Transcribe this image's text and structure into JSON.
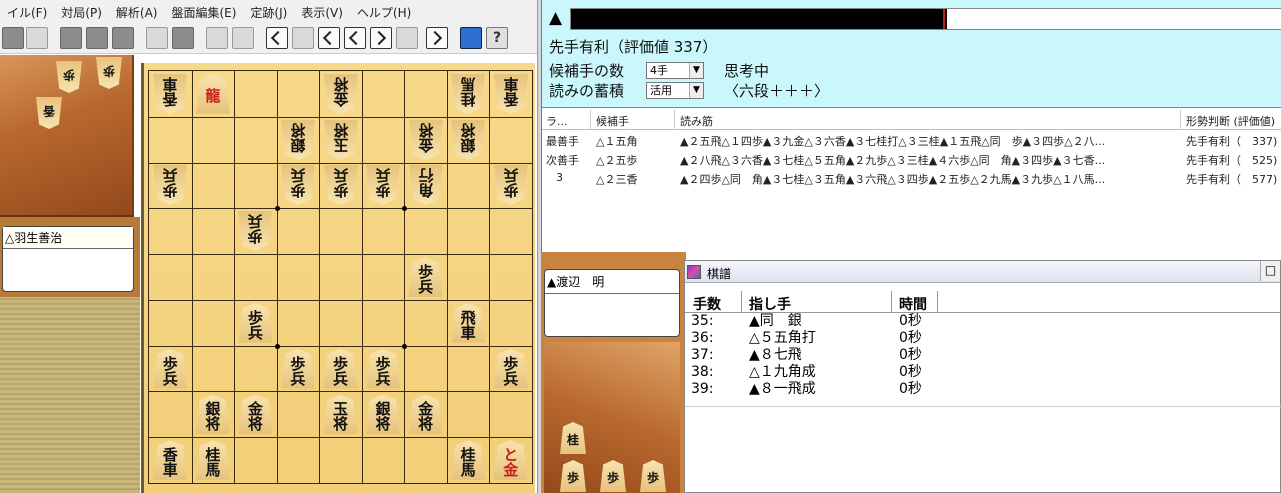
{
  "menubar": {
    "items": [
      "イル(F)",
      "対局(P)",
      "解析(A)",
      "盤面編集(E)",
      "定跡(J)",
      "表示(V)",
      "ヘルプ(H)"
    ]
  },
  "players": {
    "white_name": "△羽生善治",
    "black_name": "▲渡辺　明"
  },
  "hands": {
    "white": [
      "歩",
      "歩",
      "香"
    ],
    "black": [
      "桂",
      "歩",
      "歩",
      "歩"
    ]
  },
  "board": {
    "pieces": [
      {
        "file": 9,
        "rank": 1,
        "label": "香車",
        "side": "gote"
      },
      {
        "file": 8,
        "rank": 1,
        "label": "龍",
        "side": "sente",
        "red": true
      },
      {
        "file": 5,
        "rank": 1,
        "label": "金将",
        "side": "gote"
      },
      {
        "file": 2,
        "rank": 1,
        "label": "桂馬",
        "side": "gote"
      },
      {
        "file": 1,
        "rank": 1,
        "label": "香車",
        "side": "gote"
      },
      {
        "file": 6,
        "rank": 2,
        "label": "銀将",
        "side": "gote"
      },
      {
        "file": 5,
        "rank": 2,
        "label": "玉将",
        "side": "gote"
      },
      {
        "file": 3,
        "rank": 2,
        "label": "金将",
        "side": "gote"
      },
      {
        "file": 2,
        "rank": 2,
        "label": "銀将",
        "side": "gote"
      },
      {
        "file": 9,
        "rank": 3,
        "label": "歩兵",
        "side": "gote"
      },
      {
        "file": 6,
        "rank": 3,
        "label": "歩兵",
        "side": "gote"
      },
      {
        "file": 5,
        "rank": 3,
        "label": "歩兵",
        "side": "gote"
      },
      {
        "file": 4,
        "rank": 3,
        "label": "歩兵",
        "side": "gote"
      },
      {
        "file": 3,
        "rank": 3,
        "label": "角行",
        "side": "gote"
      },
      {
        "file": 1,
        "rank": 3,
        "label": "歩兵",
        "side": "gote"
      },
      {
        "file": 7,
        "rank": 4,
        "label": "歩兵",
        "side": "gote"
      },
      {
        "file": 3,
        "rank": 5,
        "label": "歩兵",
        "side": "sente"
      },
      {
        "file": 7,
        "rank": 6,
        "label": "歩兵",
        "side": "sente"
      },
      {
        "file": 2,
        "rank": 6,
        "label": "飛車",
        "side": "sente"
      },
      {
        "file": 9,
        "rank": 7,
        "label": "歩兵",
        "side": "sente"
      },
      {
        "file": 6,
        "rank": 7,
        "label": "歩兵",
        "side": "sente"
      },
      {
        "file": 5,
        "rank": 7,
        "label": "歩兵",
        "side": "sente"
      },
      {
        "file": 4,
        "rank": 7,
        "label": "歩兵",
        "side": "sente"
      },
      {
        "file": 1,
        "rank": 7,
        "label": "歩兵",
        "side": "sente"
      },
      {
        "file": 8,
        "rank": 8,
        "label": "銀将",
        "side": "sente"
      },
      {
        "file": 7,
        "rank": 8,
        "label": "金将",
        "side": "sente"
      },
      {
        "file": 5,
        "rank": 8,
        "label": "玉将",
        "side": "sente"
      },
      {
        "file": 4,
        "rank": 8,
        "label": "銀将",
        "side": "sente"
      },
      {
        "file": 3,
        "rank": 8,
        "label": "金将",
        "side": "sente"
      },
      {
        "file": 9,
        "rank": 9,
        "label": "香車",
        "side": "sente"
      },
      {
        "file": 8,
        "rank": 9,
        "label": "桂馬",
        "side": "sente"
      },
      {
        "file": 2,
        "rank": 9,
        "label": "桂馬",
        "side": "sente"
      },
      {
        "file": 1,
        "rank": 9,
        "label": "と金",
        "side": "sente",
        "red": true
      }
    ]
  },
  "analysis": {
    "mark": "▲",
    "eval_text": "先手有利（評価値 337）",
    "eval_bar_fraction": 0.53,
    "candidates_label": "候補手の数",
    "candidates_value": "4手",
    "status": "思考中",
    "reading_label": "読みの蓄積",
    "reading_value": "活用",
    "level": "〈六段＋＋＋〉",
    "columns": [
      "ラ...",
      "候補手",
      "読み筋",
      "形勢判断 (評価値)"
    ],
    "rows": [
      {
        "rank": "最善手",
        "move": "△１五角",
        "pv": "▲２五飛△１四歩▲３九金△３六香▲３七桂打△３三桂▲１五飛△同　歩▲３四歩△２八...",
        "judgement": "先手有利（　337)"
      },
      {
        "rank": "次善手",
        "move": "△２五歩",
        "pv": "▲２八飛△３六香▲３七桂△５五角▲２九歩△３三桂▲４六歩△同　角▲３四歩▲３七香...",
        "judgement": "先手有利（　525)"
      },
      {
        "rank": "3",
        "move": "△２三香",
        "pv": "▲２四歩△同　角▲３七桂△３五角▲３六飛△３四歩▲２五歩△２九馬▲３九歩△１八馬...",
        "judgement": "先手有利（　577)"
      }
    ]
  },
  "kifu": {
    "title": "棋譜",
    "columns": [
      "手数",
      "指し手",
      "時間"
    ],
    "rows": [
      {
        "num": "35:",
        "move": "▲同　銀",
        "time": "0秒"
      },
      {
        "num": "36:",
        "move": "△５五角打",
        "time": "0秒"
      },
      {
        "num": "37:",
        "move": "▲８七飛",
        "time": "0秒"
      },
      {
        "num": "38:",
        "move": "△１九角成",
        "time": "0秒"
      },
      {
        "num": "39:",
        "move": "▲８一飛成",
        "time": "0秒"
      }
    ]
  },
  "icons": [
    "new-icon",
    "edit-icon",
    "gray-button-icon",
    "position-icon",
    "rewind-icon",
    "back-icon",
    "forward-icon",
    "screen-icon",
    "help-icon"
  ]
}
